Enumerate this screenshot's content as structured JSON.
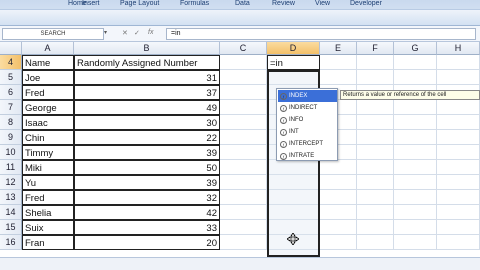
{
  "ribbon": {
    "tabs": [
      "Home",
      "Insert",
      "Page Layout",
      "Formulas",
      "Data",
      "Review",
      "View",
      "Developer"
    ]
  },
  "formula_bar": {
    "name_box": "SEARCH",
    "fx_cancel": "✕",
    "fx_enter": "✓",
    "fx": "fx",
    "value": "=in"
  },
  "columns": [
    "A",
    "B",
    "C",
    "D",
    "E",
    "F",
    "G",
    "H"
  ],
  "sheet": {
    "header_row": {
      "num": "4",
      "name": "Name",
      "value": "Randomly Assigned Number",
      "d_value": "=in"
    },
    "rows": [
      {
        "num": "5",
        "name": "Joe",
        "value": "31"
      },
      {
        "num": "6",
        "name": "Fred",
        "value": "37"
      },
      {
        "num": "7",
        "name": "George",
        "value": "49"
      },
      {
        "num": "8",
        "name": "Isaac",
        "value": "30"
      },
      {
        "num": "9",
        "name": "Chin",
        "value": "22"
      },
      {
        "num": "10",
        "name": "Timmy",
        "value": "39"
      },
      {
        "num": "11",
        "name": "Miki",
        "value": "50"
      },
      {
        "num": "12",
        "name": "Yu",
        "value": "39"
      },
      {
        "num": "13",
        "name": "Fred",
        "value": "32"
      },
      {
        "num": "14",
        "name": "Shelia",
        "value": "42"
      },
      {
        "num": "15",
        "name": "Suix",
        "value": "33"
      },
      {
        "num": "16",
        "name": "Fran",
        "value": "20"
      }
    ]
  },
  "autocomplete": {
    "items": [
      "INDEX",
      "INDIRECT",
      "INFO",
      "INT",
      "INTERCEPT",
      "INTRATE"
    ],
    "selected_index": 0,
    "tooltip": "Returns a value or reference of the cell"
  }
}
